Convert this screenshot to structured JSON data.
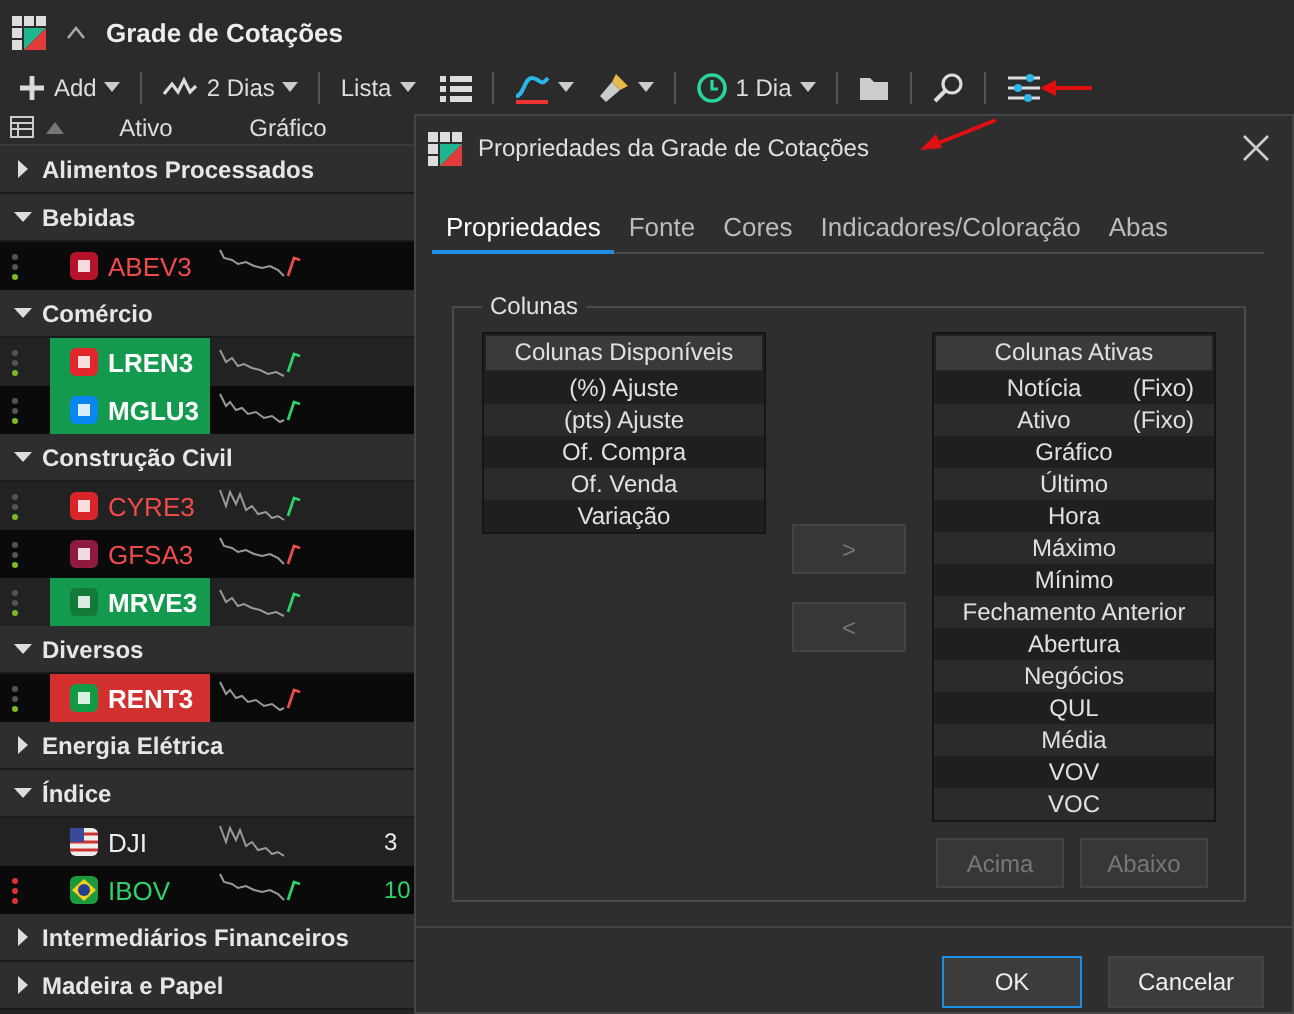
{
  "window": {
    "title": "Grade de Cotações"
  },
  "toolbar": [
    {
      "kind": "add",
      "label": "Add",
      "caret": true
    },
    {
      "kind": "period",
      "label": "2 Dias",
      "caret": true
    },
    {
      "kind": "text",
      "label": "Lista",
      "caret": true
    },
    {
      "kind": "list"
    },
    {
      "kind": "chart",
      "caret": true
    },
    {
      "kind": "brush",
      "caret": true
    },
    {
      "kind": "clock",
      "label": "1 Dia",
      "caret": true
    },
    {
      "kind": "folder"
    },
    {
      "kind": "search"
    },
    {
      "kind": "sliders"
    }
  ],
  "grid": {
    "columns": [
      "Ativo",
      "Gráfico"
    ],
    "groups": [
      {
        "name": "Alimentos Processados",
        "expanded": false
      },
      {
        "name": "Bebidas",
        "expanded": true,
        "stocks": [
          {
            "ticker": "ABEV3",
            "color": "#f04b4b",
            "dots": [
              {
                "color": "#555555"
              },
              {
                "color": "#555555"
              },
              {
                "color": "#7cb82f"
              }
            ],
            "logo": {
              "kind": "badge",
              "color": "#b5122b"
            },
            "tail": {
              "color": "#f04b4b"
            }
          }
        ]
      },
      {
        "name": "Comércio",
        "expanded": true,
        "stocks": [
          {
            "ticker": "LREN3",
            "color": "#ffffff",
            "highlight": {
              "color": "#139a4e"
            },
            "dots": [
              {
                "color": "#555555"
              },
              {
                "color": "#555555"
              },
              {
                "color": "#7cb82f"
              }
            ],
            "logo": {
              "kind": "badge",
              "color": "#e3262b"
            },
            "tail": {
              "color": "#2fd16a"
            }
          },
          {
            "ticker": "MGLU3",
            "color": "#ffffff",
            "highlight": {
              "color": "#139a4e"
            },
            "dots": [
              {
                "color": "#555555"
              },
              {
                "color": "#555555"
              },
              {
                "color": "#7cb82f"
              }
            ],
            "logo": {
              "kind": "badge",
              "color": "#0a86f0"
            },
            "tail": {
              "color": "#2fd16a"
            }
          }
        ]
      },
      {
        "name": "Construção Civil",
        "expanded": true,
        "stocks": [
          {
            "ticker": "CYRE3",
            "color": "#f04b4b",
            "dots": [
              {
                "color": "#555555"
              },
              {
                "color": "#555555"
              },
              {
                "color": "#7cb82f"
              }
            ],
            "logo": {
              "kind": "badge",
              "color": "#d9252a"
            },
            "tail": {
              "color": "#2fd16a"
            }
          },
          {
            "ticker": "GFSA3",
            "color": "#f04b4b",
            "dots": [
              {
                "color": "#555555"
              },
              {
                "color": "#555555"
              },
              {
                "color": "#7cb82f"
              }
            ],
            "logo": {
              "kind": "badge",
              "color": "#8e1a3d"
            },
            "tail": {
              "color": "#f04b4b"
            }
          },
          {
            "ticker": "MRVE3",
            "color": "#ffffff",
            "highlight": {
              "color": "#139a4e"
            },
            "dots": [
              {
                "color": "#555555"
              },
              {
                "color": "#555555"
              },
              {
                "color": "#7cb82f"
              }
            ],
            "logo": {
              "kind": "badge",
              "color": "#137a3a"
            },
            "tail": {
              "color": "#2fd16a"
            }
          }
        ]
      },
      {
        "name": "Diversos",
        "expanded": true,
        "stocks": [
          {
            "ticker": "RENT3",
            "color": "#ffffff",
            "highlight": {
              "color": "#d22f2f"
            },
            "dots": [
              {
                "color": "#555555"
              },
              {
                "color": "#555555"
              },
              {
                "color": "#7cb82f"
              }
            ],
            "logo": {
              "kind": "badge",
              "color": "#139a45"
            },
            "tail": {
              "color": "#f04b4b"
            }
          }
        ]
      },
      {
        "name": "Energia Elétrica",
        "expanded": false
      },
      {
        "name": "Índice",
        "expanded": true,
        "stocks": [
          {
            "ticker": "DJI",
            "color": "#eeeeee",
            "logo": {
              "kind": "us-flag"
            },
            "last": "3"
          },
          {
            "ticker": "IBOV",
            "color": "#2fd16a",
            "dots": [
              {
                "color": "#e03030"
              },
              {
                "color": "#e03030"
              },
              {
                "color": "#e03030"
              }
            ],
            "logo": {
              "kind": "br-flag"
            },
            "tail": {
              "color": "#2fd16a"
            },
            "last": "10"
          }
        ]
      },
      {
        "name": "Intermediários Financeiros",
        "expanded": false
      },
      {
        "name": "Madeira e Papel",
        "expanded": false
      }
    ]
  },
  "dialog": {
    "title": "Propriedades da Grade de Cotações",
    "tabs": [
      {
        "label": "Propriedades",
        "selected": true
      },
      {
        "label": "Fonte",
        "selected": false
      },
      {
        "label": "Cores",
        "selected": false
      },
      {
        "label": "Indicadores/Coloração",
        "selected": false
      },
      {
        "label": "Abas",
        "selected": false
      }
    ],
    "group_title": "Colunas",
    "available": {
      "header": "Colunas Disponíveis",
      "items": [
        {
          "label": "(%) Ajuste"
        },
        {
          "label": "(pts) Ajuste"
        },
        {
          "label": "Of. Compra"
        },
        {
          "label": "Of. Venda"
        },
        {
          "label": "Variação"
        }
      ]
    },
    "move_buttons": [
      {
        "label": ">",
        "disabled": true
      },
      {
        "label": "<",
        "disabled": true
      }
    ],
    "active": {
      "header": "Colunas Ativas",
      "items": [
        {
          "label": "Notícia",
          "tag": "(Fixo)"
        },
        {
          "label": "Ativo",
          "tag": "(Fixo)"
        },
        {
          "label": "Gráfico"
        },
        {
          "label": "Último"
        },
        {
          "label": "Hora"
        },
        {
          "label": "Máximo"
        },
        {
          "label": "Mínimo"
        },
        {
          "label": "Fechamento Anterior"
        },
        {
          "label": "Abertura"
        },
        {
          "label": "Negócios"
        },
        {
          "label": "QUL"
        },
        {
          "label": "Média"
        },
        {
          "label": "VOV"
        },
        {
          "label": "VOC"
        }
      ]
    },
    "order_buttons": [
      {
        "label": "Acima",
        "disabled": true
      },
      {
        "label": "Abaixo",
        "disabled": true
      }
    ],
    "footer_buttons": [
      {
        "label": "OK",
        "default": true
      },
      {
        "label": "Cancelar",
        "default": false
      }
    ]
  }
}
